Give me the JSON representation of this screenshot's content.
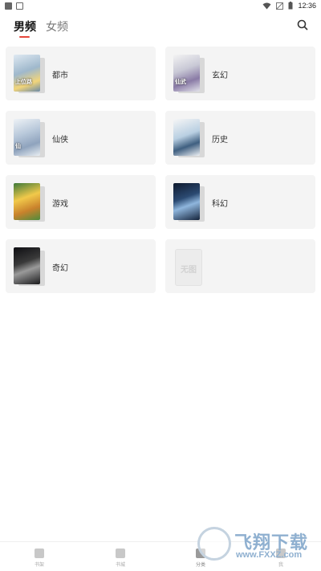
{
  "status_bar": {
    "time": "12:36"
  },
  "tabs": {
    "male": "男频",
    "female": "女频"
  },
  "categories": [
    {
      "label": "都市",
      "cover_text": "上位路"
    },
    {
      "label": "玄幻",
      "cover_text": "仙武"
    },
    {
      "label": "仙侠",
      "cover_text": "仙"
    },
    {
      "label": "历史",
      "cover_text": ""
    },
    {
      "label": "游戏",
      "cover_text": ""
    },
    {
      "label": "科幻",
      "cover_text": ""
    },
    {
      "label": "奇幻",
      "cover_text": ""
    },
    {
      "label": "",
      "cover_text": "无图"
    }
  ],
  "bottom_nav": [
    {
      "label": "书架",
      "icon": "bookshelf-icon"
    },
    {
      "label": "书城",
      "icon": "bookstore-icon"
    },
    {
      "label": "分类",
      "icon": "category-icon"
    },
    {
      "label": "我",
      "icon": "profile-icon"
    }
  ],
  "watermark": {
    "cn": "飞翔下载",
    "en": "www.FXXZ.com"
  },
  "colors": {
    "accent": "#e5453a",
    "card_bg": "#f4f4f4"
  }
}
